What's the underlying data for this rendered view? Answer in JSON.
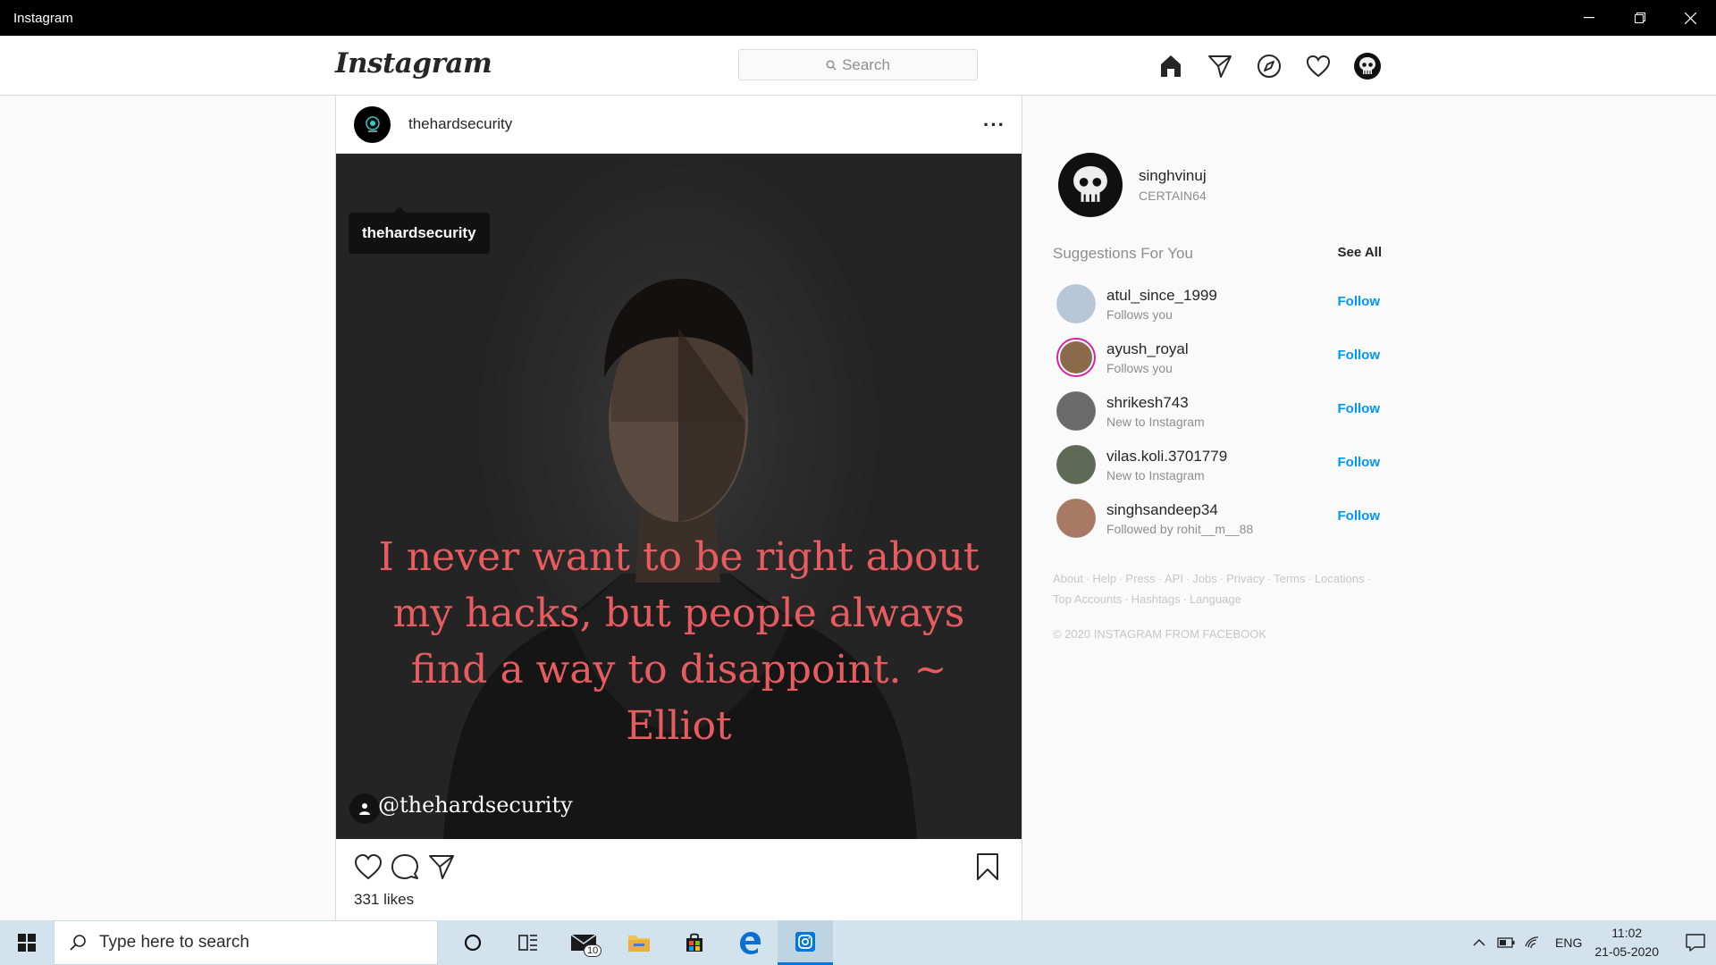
{
  "window": {
    "title": "Instagram",
    "controls": [
      "minimize",
      "restore",
      "close"
    ]
  },
  "header": {
    "logo_text": "Instagram",
    "search_placeholder": "Search",
    "nav_icons": [
      "home-icon",
      "direct-icon",
      "explore-icon",
      "activity-heart-icon",
      "profile-avatar"
    ]
  },
  "post": {
    "username": "thehardsecurity",
    "more_label": "···",
    "tag_tooltip": "thehardsecurity",
    "quote": "I never want to be right about my hacks, but people always find a way to disappoint. ~ Elliot",
    "quote_color": "#e85c5f",
    "watermark": "@thehardsecurity",
    "likes": "331 likes"
  },
  "sidebar": {
    "me": {
      "username": "singhvinuj",
      "name": "CERTAIN64"
    },
    "suggestions_title": "Suggestions For You",
    "see_all": "See All",
    "suggestions": [
      {
        "username": "atul_since_1999",
        "subtitle": "Follows you",
        "action": "Follow",
        "avatar_color": "#b8c7d8"
      },
      {
        "username": "ayush_royal",
        "subtitle": "Follows you",
        "action": "Follow",
        "avatar_color": "#8a6a4a"
      },
      {
        "username": "shrikesh743",
        "subtitle": "New to Instagram",
        "action": "Follow",
        "avatar_color": "#6b6b6b"
      },
      {
        "username": "vilas.koli.3701779",
        "subtitle": "New to Instagram",
        "action": "Follow",
        "avatar_color": "#5e6a55"
      },
      {
        "username": "singhsandeep34",
        "subtitle": "Followed by rohit__m__88",
        "action": "Follow",
        "avatar_color": "#a87a66"
      }
    ],
    "footer_links_line1": [
      "About",
      "Help",
      "Press",
      "API",
      "Jobs",
      "Privacy",
      "Terms",
      "Locations"
    ],
    "footer_links_line2": [
      "Top Accounts",
      "Hashtags",
      "Language"
    ],
    "copyright": "© 2020 INSTAGRAM FROM FACEBOOK"
  },
  "taskbar": {
    "search_placeholder": "Type here to search",
    "mail_badge": "10",
    "language": "ENG",
    "time": "11:02",
    "date": "21-05-2020",
    "accent": "#0078d7"
  }
}
